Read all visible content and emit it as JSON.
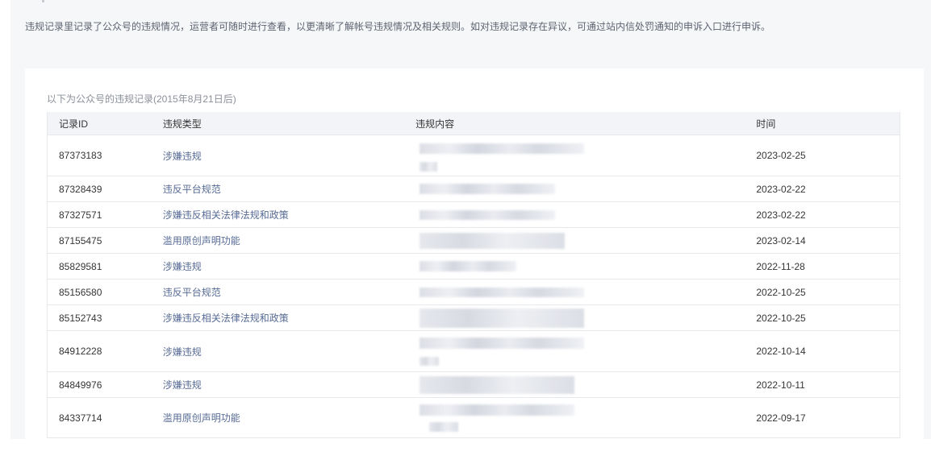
{
  "notice": "违规记录里记录了公众号的违规情况，运营者可随时进行查看，以更清晰了解帐号违规情况及相关规则。如对违规记录存在异议，可通过站内信处罚通知的申诉入口进行申诉。",
  "caption": "以下为公众号的违规记录(2015年8月21日后)",
  "columns": {
    "id": "记录ID",
    "type": "违规类型",
    "content": "违规内容",
    "time": "时间"
  },
  "rows": [
    {
      "id": "87373183",
      "type": "涉嫌违规",
      "time": "2023-02-25"
    },
    {
      "id": "87328439",
      "type": "违反平台规范",
      "time": "2023-02-22"
    },
    {
      "id": "87327571",
      "type": "涉嫌违反相关法律法规和政策",
      "time": "2023-02-22"
    },
    {
      "id": "87155475",
      "type": "滥用原创声明功能",
      "time": "2023-02-14"
    },
    {
      "id": "85829581",
      "type": "涉嫌违规",
      "time": "2022-11-28"
    },
    {
      "id": "85156580",
      "type": "违反平台规范",
      "time": "2022-10-25"
    },
    {
      "id": "85152743",
      "type": "涉嫌违反相关法律法规和政策",
      "time": "2022-10-25"
    },
    {
      "id": "84912228",
      "type": "涉嫌违规",
      "time": "2022-10-14"
    },
    {
      "id": "84849976",
      "type": "涉嫌违规",
      "time": "2022-10-11"
    },
    {
      "id": "84337714",
      "type": "滥用原创声明功能",
      "time": "2022-09-17"
    }
  ],
  "colors": {
    "link": "#576b95",
    "header_bg": "#f3f4f7",
    "page_bg": "#f6f7f9"
  }
}
